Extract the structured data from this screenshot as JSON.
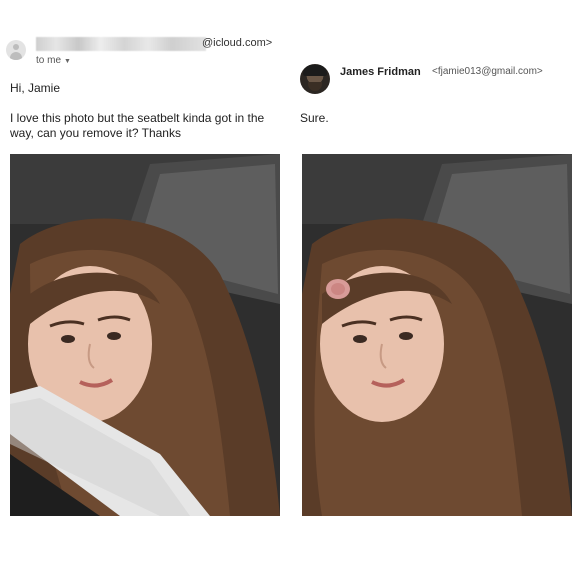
{
  "left_email": {
    "sender_domain": "@icloud.com>",
    "recipient": "to me",
    "greeting": "Hi, Jamie",
    "message_line1": "I love this photo but the seatbelt kinda got in the",
    "message_line2": "way, can you remove it? Thanks"
  },
  "right_email": {
    "sender_name": "James Fridman",
    "sender_email": "<fjamie013@gmail.com>",
    "reply": "Sure."
  },
  "icons": [
    "avatar-generic-icon",
    "caret-down-icon"
  ]
}
